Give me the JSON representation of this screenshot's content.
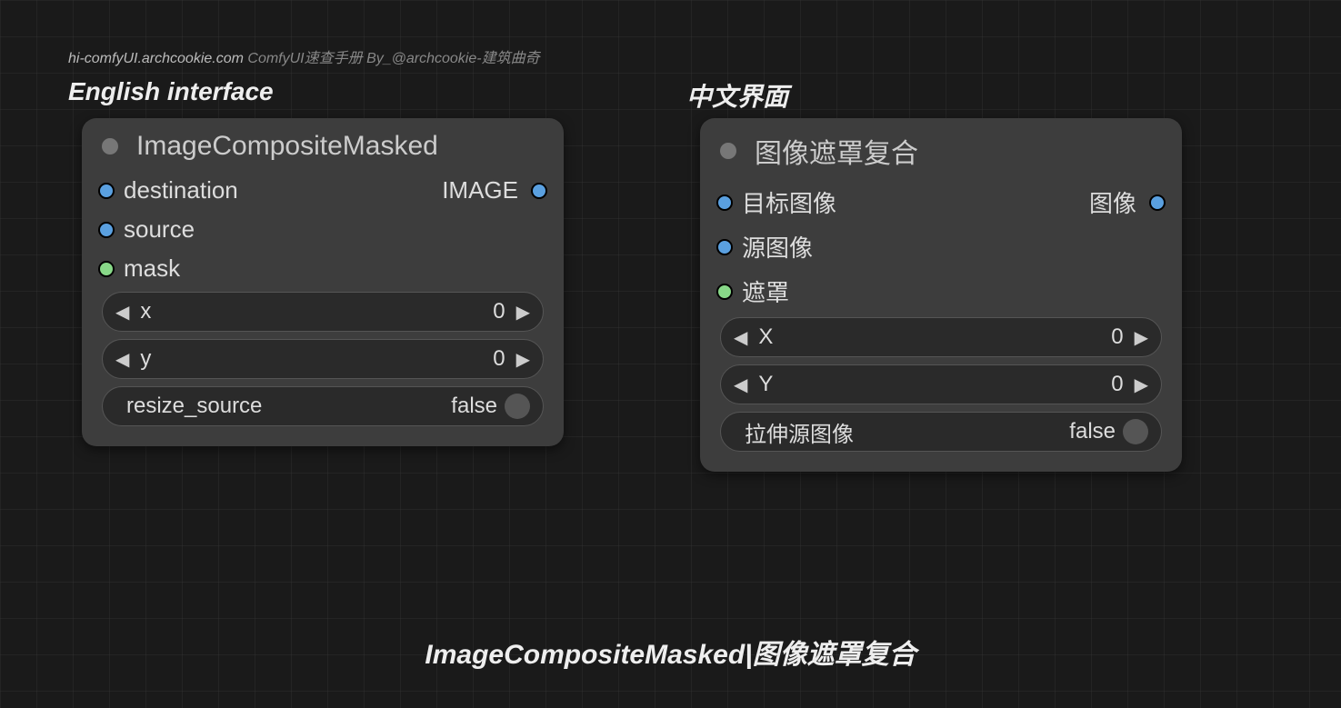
{
  "watermark": {
    "url": "hi-comfyUI.archcookie.com",
    "rest": " ComfyUI速查手册 By_@archcookie-建筑曲奇"
  },
  "heading_en": "English interface",
  "heading_cn": "中文界面",
  "caption": "ImageCompositeMasked|图像遮罩复合",
  "node_en": {
    "title": "ImageCompositeMasked",
    "inputs": {
      "destination": "destination",
      "source": "source",
      "mask": "mask"
    },
    "output": "IMAGE",
    "widgets": {
      "x_label": "x",
      "x_value": "0",
      "y_label": "y",
      "y_value": "0",
      "resize_label": "resize_source",
      "resize_value": "false"
    }
  },
  "node_cn": {
    "title": "图像遮罩复合",
    "inputs": {
      "destination": "目标图像",
      "source": "源图像",
      "mask": "遮罩"
    },
    "output": "图像",
    "widgets": {
      "x_label": "X",
      "x_value": "0",
      "y_label": "Y",
      "y_value": "0",
      "resize_label": "拉伸源图像",
      "resize_value": "false"
    }
  }
}
